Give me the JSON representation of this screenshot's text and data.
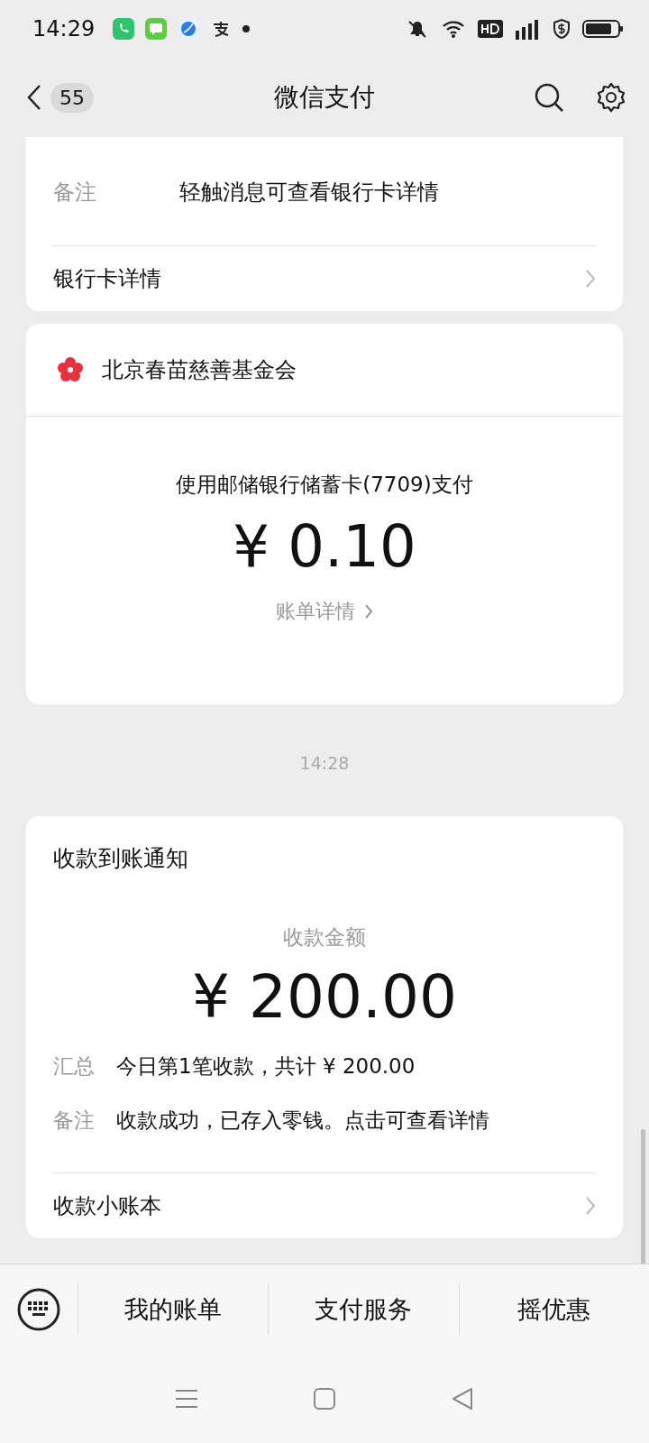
{
  "status_bar": {
    "time": "14:29"
  },
  "header": {
    "back_count": "55",
    "title": "微信支付"
  },
  "messages": [
    {
      "kind": "bank",
      "rows": [
        {
          "label": "备注",
          "value": "轻触消息可查看银行卡详情"
        }
      ],
      "link": "银行卡详情"
    },
    {
      "kind": "payment",
      "merchant": "北京春苗慈善基金会",
      "method": "使用邮储银行储蓄卡(7709)支付",
      "amount": "¥ 0.10",
      "link": "账单详情"
    },
    {
      "kind": "time",
      "text": "14:28"
    },
    {
      "kind": "receipt",
      "title": "收款到账通知",
      "amount_label": "收款金额",
      "amount": "¥ 200.00",
      "rows": [
        {
          "label": "汇总",
          "value": "今日第1笔收款，共计 ¥ 200.00"
        },
        {
          "label": "备注",
          "value": "收款成功，已存入零钱。点击可查看详情"
        }
      ],
      "link": "收款小账本"
    }
  ],
  "bottom_menu": [
    "我的账单",
    "支付服务",
    "摇优惠"
  ]
}
